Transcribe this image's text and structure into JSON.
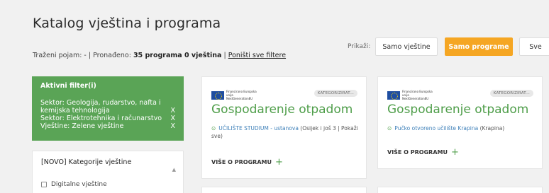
{
  "header": {
    "title": "Katalog vještina i programa",
    "search_prefix": "Traženi pojam: - | Pronađeno: ",
    "search_count": "35 programa 0 vještina",
    "search_sep": " | ",
    "reset_label": "Poništi sve filtere"
  },
  "view_toggle": {
    "label": "Prikaži:",
    "skills": "Samo vještine",
    "programs": "Samo programe",
    "all": "Sve"
  },
  "active_filters": {
    "title": "Aktivni filter(i)",
    "items": [
      {
        "label": "Sektor: Geologija, rudarstvo, nafta i kemijska tehnologija",
        "remove": "X"
      },
      {
        "label": "Sektor: Elektrotehnika i računarstvo",
        "remove": "X"
      },
      {
        "label": "Vještine: Zelene vještine",
        "remove": "X"
      }
    ]
  },
  "skill_categories": {
    "title": "[NOVO] Kategorije vještine",
    "items": [
      {
        "label": "Digitalne vještine"
      }
    ]
  },
  "cards": [
    {
      "badge": "KATEGORIZIRAT...",
      "title": "Gospodarenje otpadom",
      "institution": "UČILIŠTE STUDIUM - ustanova",
      "location": " (Osijek i još 3 | Pokaži sve)",
      "more_label": "VIŠE O PROGRAMU"
    },
    {
      "badge": "KATEGORIZIRAT...",
      "title": "Gospodarenje otpadom",
      "institution": "Pučko otvoreno učilište Krapina",
      "location": " (Krapina)",
      "more_label": "VIŠE O PROGRAMU"
    }
  ],
  "eu_logo_text": "Financirano Europska unija NextGenerationEU",
  "colors": {
    "accent_green": "#5aa456",
    "title_green": "#4f9e4a",
    "orange": "#f5a623"
  }
}
